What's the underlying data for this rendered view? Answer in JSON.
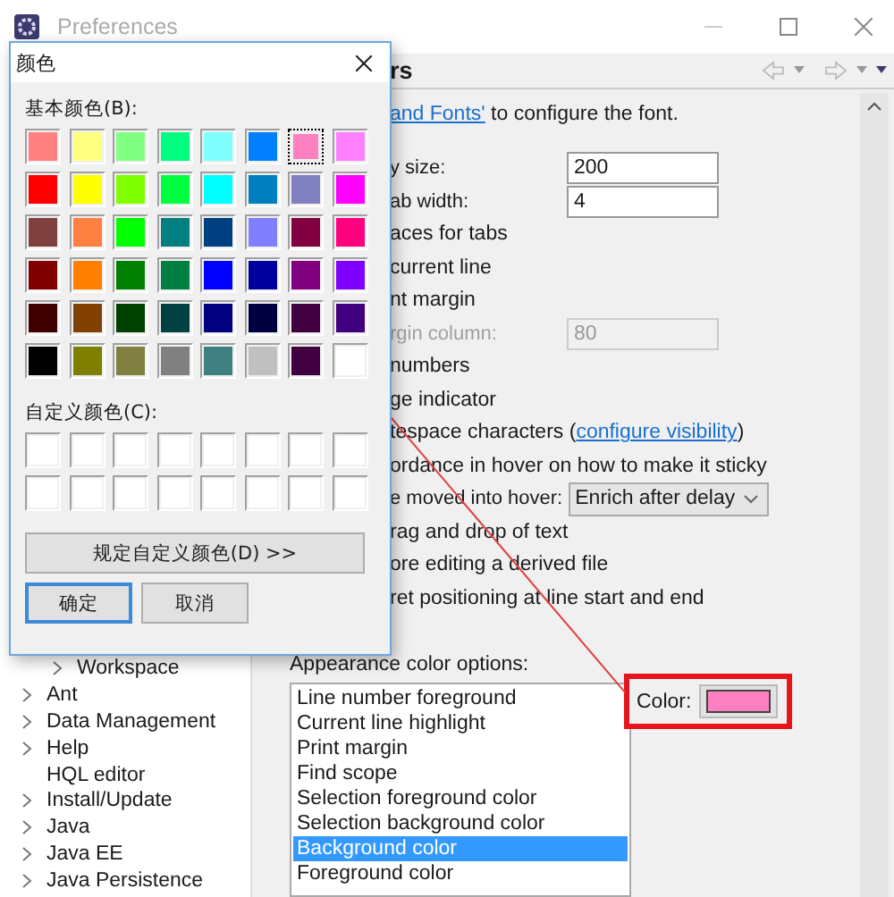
{
  "window": {
    "title": "Preferences"
  },
  "page_header": {
    "title": "rs"
  },
  "options": [
    {
      "kind": "link_lead",
      "link": "and Fonts'",
      "text": " to configure the font."
    },
    {
      "kind": "field",
      "label": "y size:",
      "value": "200",
      "disabled": false
    },
    {
      "kind": "field",
      "label": "ab width:",
      "value": "4",
      "disabled": false
    },
    {
      "kind": "text",
      "label": "aces for tabs"
    },
    {
      "kind": "text",
      "label": "current line"
    },
    {
      "kind": "text",
      "label": "nt margin"
    },
    {
      "kind": "field",
      "label": "rgin column:",
      "value": "80",
      "disabled": true
    },
    {
      "kind": "text",
      "label": "numbers"
    },
    {
      "kind": "text",
      "label": "ge indicator"
    },
    {
      "kind": "link_mid",
      "label": "tespace characters (",
      "link": "configure visibility",
      "text": ")"
    },
    {
      "kind": "text",
      "label": "ordance in hover on how to make it sticky"
    },
    {
      "kind": "dropdown",
      "label": "e moved into hover:",
      "value": "Enrich after delay"
    },
    {
      "kind": "text",
      "label": "rag and drop of text"
    },
    {
      "kind": "text",
      "label": "ore editing a derived file"
    },
    {
      "kind": "text",
      "label": "ret positioning at line start and end"
    }
  ],
  "appearance": {
    "label": "Appearance color options:",
    "items": [
      {
        "label": "Line number foreground",
        "selected": false
      },
      {
        "label": "Current line highlight",
        "selected": false
      },
      {
        "label": "Print margin",
        "selected": false
      },
      {
        "label": "Find scope",
        "selected": false
      },
      {
        "label": "Selection foreground color",
        "selected": false
      },
      {
        "label": "Selection background color",
        "selected": false
      },
      {
        "label": "Background color",
        "selected": true
      },
      {
        "label": "Foreground color",
        "selected": false
      }
    ],
    "color_label": "Color:",
    "color": "#ff80c0"
  },
  "sidebar": {
    "items": [
      {
        "children": [
          {
            "label": "Workspace",
            "expandable": true
          }
        ]
      },
      {
        "label": "Ant",
        "expandable": true
      },
      {
        "label": "Data Management",
        "expandable": true
      },
      {
        "label": "Help",
        "expandable": true
      },
      {
        "label": "HQL editor",
        "expandable": false
      },
      {
        "label": "Install/Update",
        "expandable": true
      },
      {
        "label": "Java",
        "expandable": true
      },
      {
        "label": "Java EE",
        "expandable": true
      },
      {
        "label": "Java Persistence",
        "expandable": true
      }
    ]
  },
  "color_dialog": {
    "title": "颜色",
    "basic_label": "基本颜色(B):",
    "basic_colors": [
      {
        "color": "#ff8080",
        "selected": false
      },
      {
        "color": "#ffff80",
        "selected": false
      },
      {
        "color": "#80ff80",
        "selected": false
      },
      {
        "color": "#00ff80",
        "selected": false
      },
      {
        "color": "#80ffff",
        "selected": false
      },
      {
        "color": "#0080ff",
        "selected": false
      },
      {
        "color": "#ff80c0",
        "selected": true
      },
      {
        "color": "#ff80ff",
        "selected": false
      },
      {
        "color": "#ff0000",
        "selected": false
      },
      {
        "color": "#ffff00",
        "selected": false
      },
      {
        "color": "#80ff00",
        "selected": false
      },
      {
        "color": "#00ff40",
        "selected": false
      },
      {
        "color": "#00ffff",
        "selected": false
      },
      {
        "color": "#0080c0",
        "selected": false
      },
      {
        "color": "#8080c0",
        "selected": false
      },
      {
        "color": "#ff00ff",
        "selected": false
      },
      {
        "color": "#804040",
        "selected": false
      },
      {
        "color": "#ff8040",
        "selected": false
      },
      {
        "color": "#00ff00",
        "selected": false
      },
      {
        "color": "#008080",
        "selected": false
      },
      {
        "color": "#004080",
        "selected": false
      },
      {
        "color": "#8080ff",
        "selected": false
      },
      {
        "color": "#800040",
        "selected": false
      },
      {
        "color": "#ff0080",
        "selected": false
      },
      {
        "color": "#800000",
        "selected": false
      },
      {
        "color": "#ff8000",
        "selected": false
      },
      {
        "color": "#008000",
        "selected": false
      },
      {
        "color": "#008040",
        "selected": false
      },
      {
        "color": "#0000ff",
        "selected": false
      },
      {
        "color": "#0000a0",
        "selected": false
      },
      {
        "color": "#800080",
        "selected": false
      },
      {
        "color": "#8000ff",
        "selected": false
      },
      {
        "color": "#400000",
        "selected": false
      },
      {
        "color": "#804000",
        "selected": false
      },
      {
        "color": "#004000",
        "selected": false
      },
      {
        "color": "#004040",
        "selected": false
      },
      {
        "color": "#000080",
        "selected": false
      },
      {
        "color": "#000040",
        "selected": false
      },
      {
        "color": "#400040",
        "selected": false
      },
      {
        "color": "#400080",
        "selected": false
      },
      {
        "color": "#000000",
        "selected": false
      },
      {
        "color": "#808000",
        "selected": false
      },
      {
        "color": "#808040",
        "selected": false
      },
      {
        "color": "#808080",
        "selected": false
      },
      {
        "color": "#408080",
        "selected": false
      },
      {
        "color": "#c0c0c0",
        "selected": false
      },
      {
        "color": "#400040",
        "selected": false
      },
      {
        "color": "#ffffff",
        "selected": false
      }
    ],
    "custom_label": "自定义颜色(C):",
    "custom_colors": [
      {
        "color": "#ffffff"
      },
      {
        "color": "#ffffff"
      },
      {
        "color": "#ffffff"
      },
      {
        "color": "#ffffff"
      },
      {
        "color": "#ffffff"
      },
      {
        "color": "#ffffff"
      },
      {
        "color": "#ffffff"
      },
      {
        "color": "#ffffff"
      },
      {
        "color": "#ffffff"
      },
      {
        "color": "#ffffff"
      },
      {
        "color": "#ffffff"
      },
      {
        "color": "#ffffff"
      },
      {
        "color": "#ffffff"
      },
      {
        "color": "#ffffff"
      },
      {
        "color": "#ffffff"
      },
      {
        "color": "#ffffff"
      }
    ],
    "define_button": "规定自定义颜色(D) >>",
    "ok_button": "确定",
    "cancel_button": "取消"
  }
}
